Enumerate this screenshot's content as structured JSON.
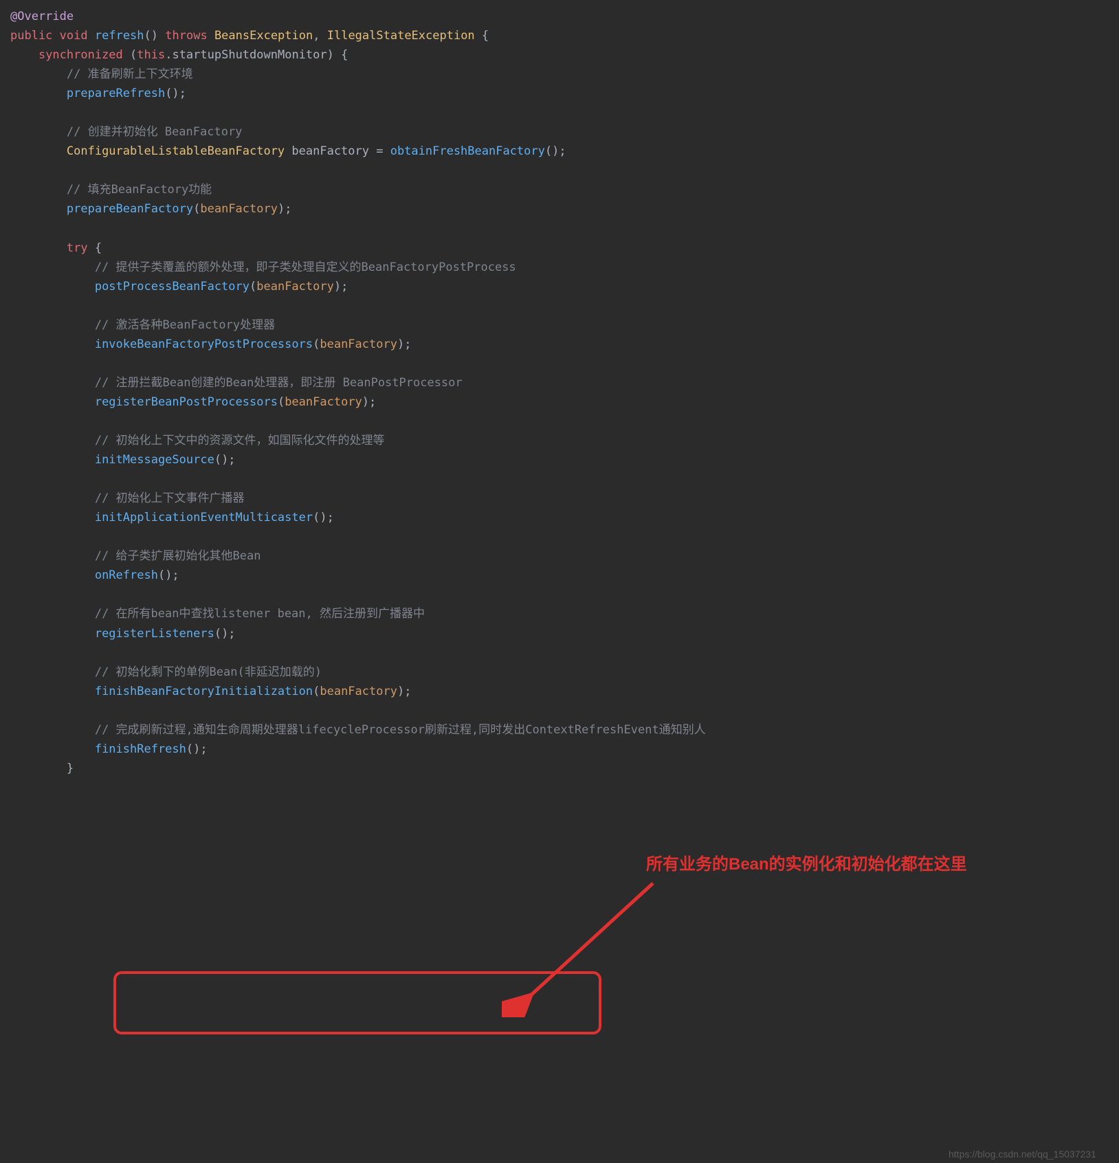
{
  "code": {
    "l1_annotation": "@Override",
    "l2_kw_public": "public",
    "l2_kw_void": "void",
    "l2_method": "refresh",
    "l2_parens": "()",
    "l2_throws": "throws",
    "l2_exc1": "BeansException",
    "l2_comma": ",",
    "l2_exc2": "IllegalStateException",
    "l2_brace": " {",
    "l3_sync": "synchronized",
    "l3_open": " (",
    "l3_this": "this",
    "l3_field": ".startupShutdownMonitor",
    "l3_close": ") {",
    "c1": "// 准备刷新上下文环境",
    "m1": "prepareRefresh",
    "m1_call": "();",
    "c2": "// 创建并初始化 BeanFactory",
    "l7_type1": "ConfigurableListableBeanFactory",
    "l7_var": " beanFactory = ",
    "l7_m": "obtainFreshBeanFactory",
    "l7_call": "();",
    "c3": "// 填充BeanFactory功能",
    "m3": "prepareBeanFactory",
    "m3_call_open": "(",
    "m3_arg": "beanFactory",
    "m3_call_close": ");",
    "try_kw": "try",
    "try_brace": " {",
    "c4": "// 提供子类覆盖的额外处理，即子类处理自定义的BeanFactoryPostProcess",
    "m4": "postProcessBeanFactory",
    "c5": "// 激活各种BeanFactory处理器",
    "m5": "invokeBeanFactoryPostProcessors",
    "c6": "// 注册拦截Bean创建的Bean处理器，即注册 BeanPostProcessor",
    "m6": "registerBeanPostProcessors",
    "c7": "// 初始化上下文中的资源文件，如国际化文件的处理等",
    "m7": "initMessageSource",
    "m7_call": "();",
    "c8": "// 初始化上下文事件广播器",
    "m8": "initApplicationEventMulticaster",
    "c9": "// 给子类扩展初始化其他Bean",
    "m9": "onRefresh",
    "c10": "// 在所有bean中查找listener bean, 然后注册到广播器中",
    "m10": "registerListeners",
    "c11": "// 初始化剩下的单例Bean(非延迟加载的)",
    "m11": "finishBeanFactoryInitialization",
    "c12": "// 完成刷新过程,通知生命周期处理器lifecycleProcessor刷新过程,同时发出ContextRefreshEvent通知别人",
    "m12": "finishRefresh",
    "close_brace": "}"
  },
  "callout": "所有业务的Bean的实例化和初始化都在这里",
  "watermark": "https://blog.csdn.net/qq_15037231"
}
